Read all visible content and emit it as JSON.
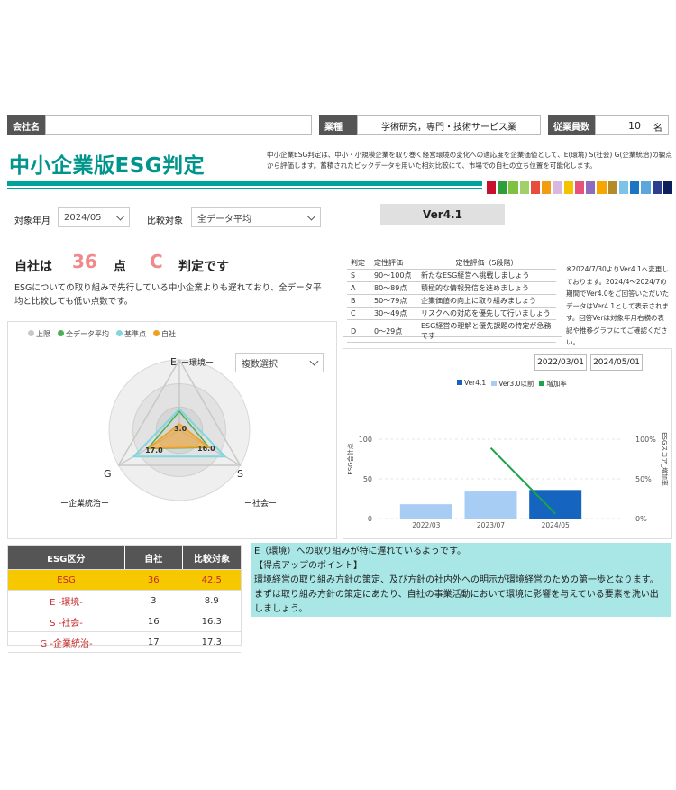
{
  "header": {
    "company_label": "会社名",
    "company_value": "",
    "industry_label": "業種",
    "industry_value": "学術研究，専門・技術サービス業",
    "employees_label": "従業員数",
    "employees_value": "10",
    "employees_unit": "名"
  },
  "title": "中小企業版ESG判定",
  "description": "中小企業ESG判定は、中小・小規模企業を取り巻く経営環境の変化への適応度を企業価値として、E(環境) S(社会) G(企業統治)の観点から評価します。蓄積されたビックデータを用いた相対比較にて、市場での自社の立ち位置を可能化します。",
  "color_strip": [
    "#c8102e",
    "#2d9e3a",
    "#7fc241",
    "#9fd06a",
    "#e84c3d",
    "#f39c12",
    "#d9b8e0",
    "#f4c300",
    "#e6527a",
    "#8e6bbf",
    "#f7a600",
    "#b38b2b",
    "#7cc3e8",
    "#1a75c4",
    "#5aa6dd",
    "#2c3e8f",
    "#0a1f5c"
  ],
  "filters": {
    "month_label": "対象年月",
    "month_value": "2024/05",
    "compare_label": "比較対象",
    "compare_value": "全データ平均",
    "version": "Ver4.1"
  },
  "score": {
    "prefix": "自社は",
    "points": "36",
    "points_unit": "点",
    "grade": "C",
    "suffix": "判定です",
    "comment": "ESGについての取り組みで先行している中小企業よりも遅れており、全データ平均と比較しても低い点数です。"
  },
  "grade_table": {
    "headers": [
      "判定",
      "定性評価",
      "定性評価（5段階）"
    ],
    "rows": [
      [
        "S",
        "90～100点",
        "新たなESG経営へ挑戦しましょう"
      ],
      [
        "A",
        "80～89点",
        "積極的な情報発信を進めましょう"
      ],
      [
        "B",
        "50～79点",
        "企業価値の向上に取り組みましょう"
      ],
      [
        "C",
        "30～49点",
        "リスクへの対応を優先して行いましょう"
      ],
      [
        "D",
        "0～29点",
        "ESG経営の理解と優先課題の特定が急務です"
      ]
    ]
  },
  "version_note": "※2024/7/30よりVer4.1へ変更しております。2024/4～2024/7の期間でVer4.0をご回答いただいたデータはVer4.1として表示されます。回答Verは対象年月右横の表記や推移グラフにてご確認ください。",
  "radar": {
    "legend": [
      {
        "name": "上限",
        "color": "#c8c8c8"
      },
      {
        "name": "全データ平均",
        "color": "#4caf50"
      },
      {
        "name": "基準点",
        "color": "#7fd7e0"
      },
      {
        "name": "自社",
        "color": "#f0a020"
      }
    ],
    "dropdown": "複数選択",
    "axis_e": "E",
    "axis_e_label": "ー環境ー",
    "axis_s": "S",
    "axis_s_label": "ー社会ー",
    "axis_g": "G",
    "axis_g_label": "ー企業統治ー",
    "value_e": "3.0",
    "value_s": "16.0",
    "value_g": "17.0"
  },
  "chart_data": [
    {
      "type": "radar",
      "axes": [
        "E",
        "S",
        "G"
      ],
      "max": 33.3,
      "series": [
        {
          "name": "上限",
          "values": [
            33.3,
            33.3,
            33.3
          ]
        },
        {
          "name": "全データ平均",
          "values": [
            8.9,
            16.3,
            17.3
          ]
        },
        {
          "name": "基準点",
          "values": [
            10,
            25,
            25
          ]
        },
        {
          "name": "自社",
          "values": [
            3.0,
            16.0,
            17.0
          ]
        }
      ]
    },
    {
      "type": "bar",
      "dates": [
        "2022/03/01",
        "2024/05/01"
      ],
      "categories": [
        "2022/03",
        "2023/07",
        "2024/05"
      ],
      "ylabel": "ESG合計点",
      "y2label": "ESGスコア_増加率",
      "ylim": [
        0,
        150
      ],
      "y2lim": [
        0,
        1.5
      ],
      "left_ticks": [
        "0",
        "50",
        "100"
      ],
      "right_ticks": [
        "0%",
        "50%",
        "100%"
      ],
      "legend": [
        {
          "name": "Ver4.1",
          "color": "#1565c0"
        },
        {
          "name": "Ver3.0以前",
          "color": "#a7cdf5"
        },
        {
          "name": "増加率",
          "color": "#1aa34a"
        }
      ],
      "bars": [
        {
          "category": "2022/03",
          "value": 18,
          "series": "Ver3.0以前"
        },
        {
          "category": "2023/07",
          "value": 34,
          "series": "Ver3.0以前"
        },
        {
          "category": "2024/05",
          "value": 36,
          "series": "Ver4.1"
        }
      ],
      "line": {
        "name": "増加率",
        "points": [
          {
            "category": "2023/07",
            "value": 0.89
          },
          {
            "category": "2024/05",
            "value": 0.06
          }
        ]
      }
    }
  ],
  "score_table": {
    "headers": [
      "ESG区分",
      "自社",
      "比較対象"
    ],
    "rows": [
      [
        "ESG",
        "36",
        "42.5"
      ],
      [
        "E -環境-",
        "3",
        "8.9"
      ],
      [
        "S -社会-",
        "16",
        "16.3"
      ],
      [
        "G -企業統治-",
        "17",
        "17.3"
      ]
    ]
  },
  "advice": {
    "line1": "E（環境）への取り組みが特に遅れているようです。",
    "line2": "【得点アップのポイント】",
    "body": "環境経営の取り組み方針の策定、及び方針の社内外への明示が環境経営のための第一歩となります。まずは取り組み方針の策定にあたり、自社の事業活動において環境に影響を与えている要素を洗い出しましょう。"
  },
  "colors": {
    "accent": "#00a39a",
    "title": "#00958c",
    "score": "#f08a8a",
    "highlight": "#f5c800",
    "advice_bg": "#a9e6e6"
  }
}
